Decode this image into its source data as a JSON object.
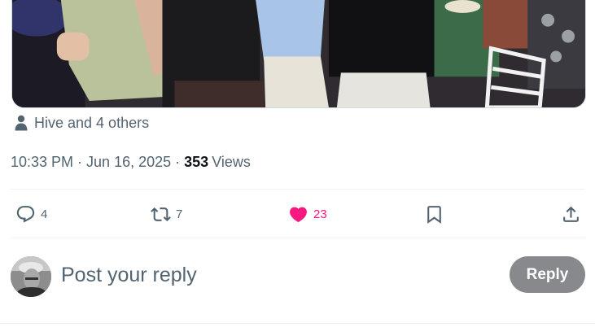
{
  "tweet": {
    "media_alt": "",
    "tagged_text": "Hive and 4 others",
    "time": "10:33 PM",
    "date": "Jun 16, 2025",
    "separator": "·",
    "views_count": "353",
    "views_label": "Views"
  },
  "actions": {
    "replies": {
      "count": "4",
      "icon": "reply-icon"
    },
    "reposts": {
      "count": "7",
      "icon": "repost-icon"
    },
    "likes": {
      "count": "23",
      "icon": "heart-icon",
      "liked": true,
      "color": "#f91880"
    },
    "bookmark": {
      "icon": "bookmark-icon"
    },
    "share": {
      "icon": "share-icon"
    }
  },
  "reply": {
    "placeholder": "Post your reply",
    "button_label": "Reply",
    "button_color": "#87898c"
  },
  "colors": {
    "secondary_text": "#536471",
    "primary_text": "#0f1419",
    "divider": "#eff3f4",
    "like": "#f91880"
  }
}
